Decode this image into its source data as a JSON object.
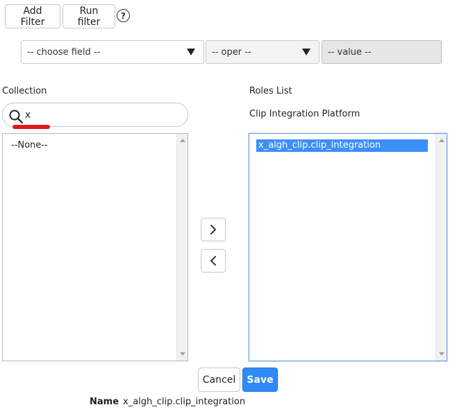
{
  "toolbar": {
    "add_filter_label": "Add Filter",
    "run_filter_label": "Run filter",
    "help_symbol": "?"
  },
  "filter": {
    "field_selected": "-- choose field --",
    "oper_selected": "-- oper --",
    "value_placeholder": "-- value --"
  },
  "collection": {
    "label": "Collection",
    "search_value": "x",
    "items": [
      "--None--"
    ]
  },
  "roles": {
    "label": "Roles List",
    "subtitle": "Clip Integration Platform",
    "items": [
      "x_algh_clip.clip_integration"
    ]
  },
  "actions": {
    "cancel_label": "Cancel",
    "save_label": "Save"
  },
  "name_field": {
    "label": "Name",
    "value": "x_algh_clip.clip_integration"
  },
  "colors": {
    "accent": "#2f8af5",
    "selection": "#3b8ff7",
    "annotation": "#e21818"
  },
  "icons": [
    "help-icon",
    "caret-down-icon",
    "search-icon",
    "chevron-right-icon",
    "chevron-left-icon"
  ]
}
